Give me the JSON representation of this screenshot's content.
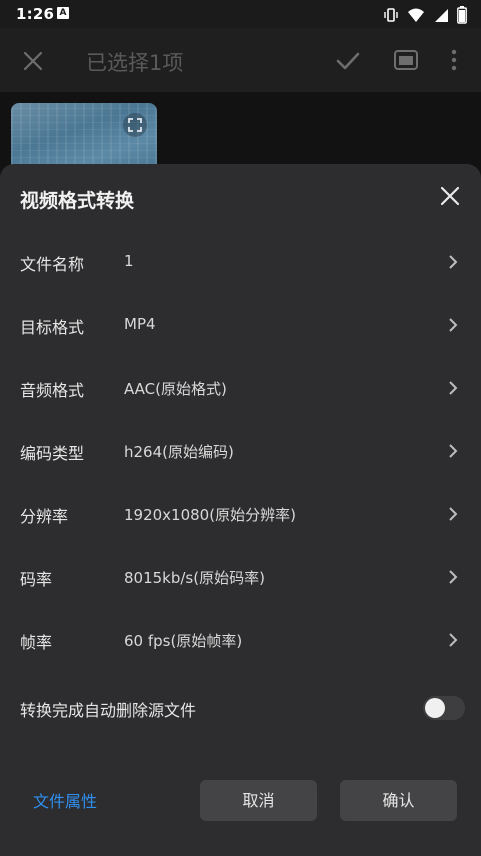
{
  "status_bar": {
    "time": "1:26",
    "left_icon": "A",
    "icons": [
      "vibrate-icon",
      "wifi-icon",
      "signal-icon",
      "battery-icon"
    ]
  },
  "app_bar": {
    "title": "已选择1项"
  },
  "sheet": {
    "title": "视频格式转换",
    "rows": [
      {
        "label": "文件名称",
        "value": "1"
      },
      {
        "label": "目标格式",
        "value": "MP4"
      },
      {
        "label": "音频格式",
        "value": "AAC(原始格式)"
      },
      {
        "label": "编码类型",
        "value": "h264(原始编码)"
      },
      {
        "label": "分辨率",
        "value": "1920x1080(原始分辨率)"
      },
      {
        "label": "码率",
        "value": "8015kb/s(原始码率)"
      },
      {
        "label": "帧率",
        "value": "60 fps(原始帧率)"
      }
    ],
    "toggle": {
      "label": "转换完成自动删除源文件",
      "on": false
    },
    "file_props": "文件属性",
    "cancel": "取消",
    "confirm": "确认"
  },
  "colors": {
    "accent": "#2f8ff0",
    "sheet_bg": "#2d2d2f",
    "button_bg": "#444446"
  }
}
